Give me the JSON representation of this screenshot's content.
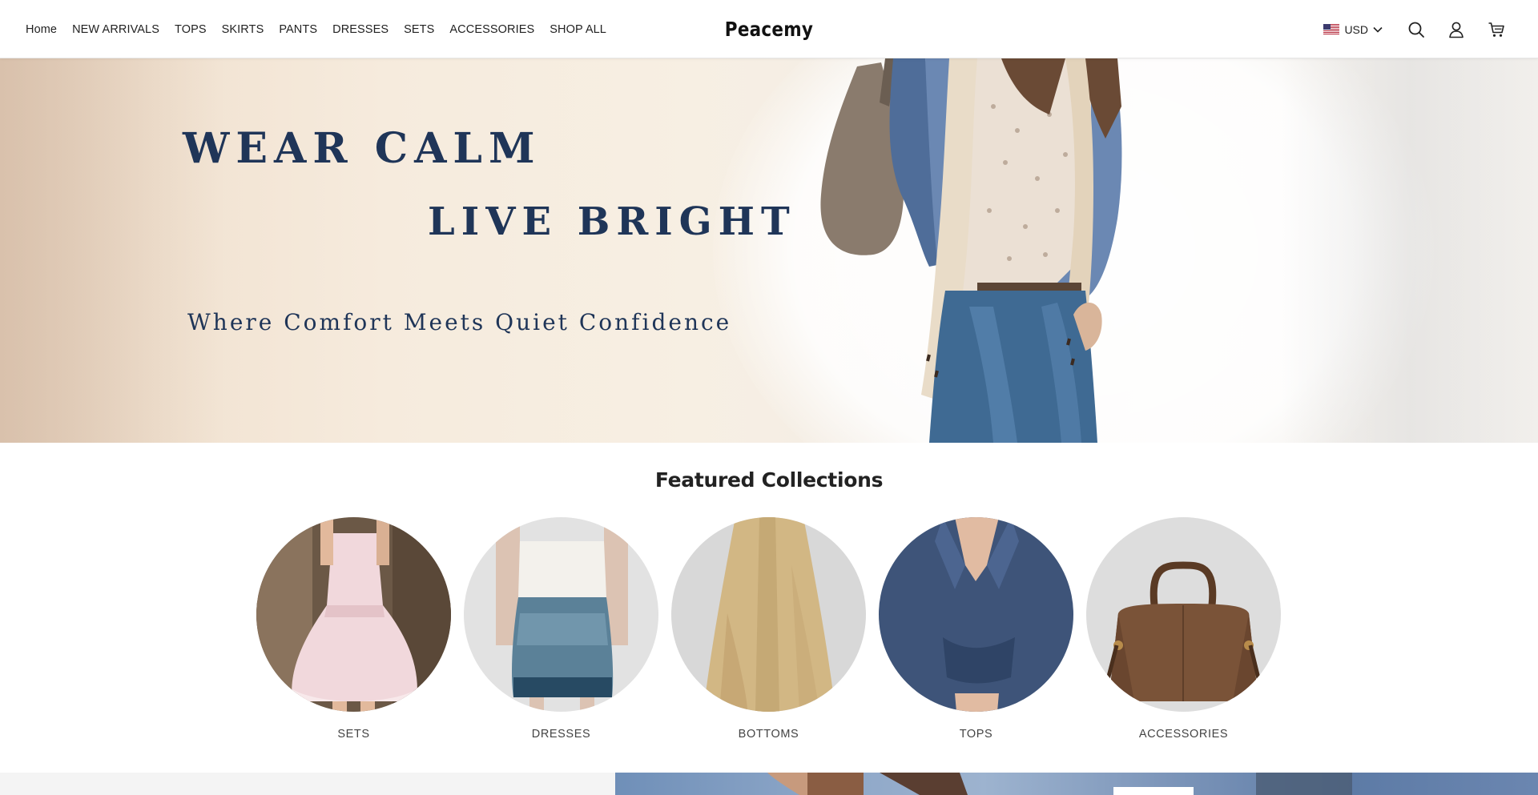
{
  "header": {
    "nav": [
      {
        "label": "Home"
      },
      {
        "label": "NEW ARRIVALS"
      },
      {
        "label": "TOPS"
      },
      {
        "label": "SKIRTS"
      },
      {
        "label": "PANTS"
      },
      {
        "label": "DRESSES"
      },
      {
        "label": "SETS"
      },
      {
        "label": "ACCESSORIES"
      },
      {
        "label": "SHOP ALL"
      }
    ],
    "brand": "Peacemy",
    "currency": "USD",
    "icons": [
      "us-flag-icon",
      "chevron-down-icon",
      "search-icon",
      "account-icon",
      "cart-icon"
    ]
  },
  "hero": {
    "line1": "WEAR CALM",
    "line2": "LIVE BRIGHT",
    "tagline": "Where Comfort Meets Quiet Confidence",
    "text_color": "#1f3558"
  },
  "featured": {
    "title": "Featured Collections",
    "collections": [
      {
        "label": "SETS"
      },
      {
        "label": "DRESSES"
      },
      {
        "label": "BOTTOMS"
      },
      {
        "label": "TOPS"
      },
      {
        "label": "ACCESSORIES"
      }
    ]
  }
}
